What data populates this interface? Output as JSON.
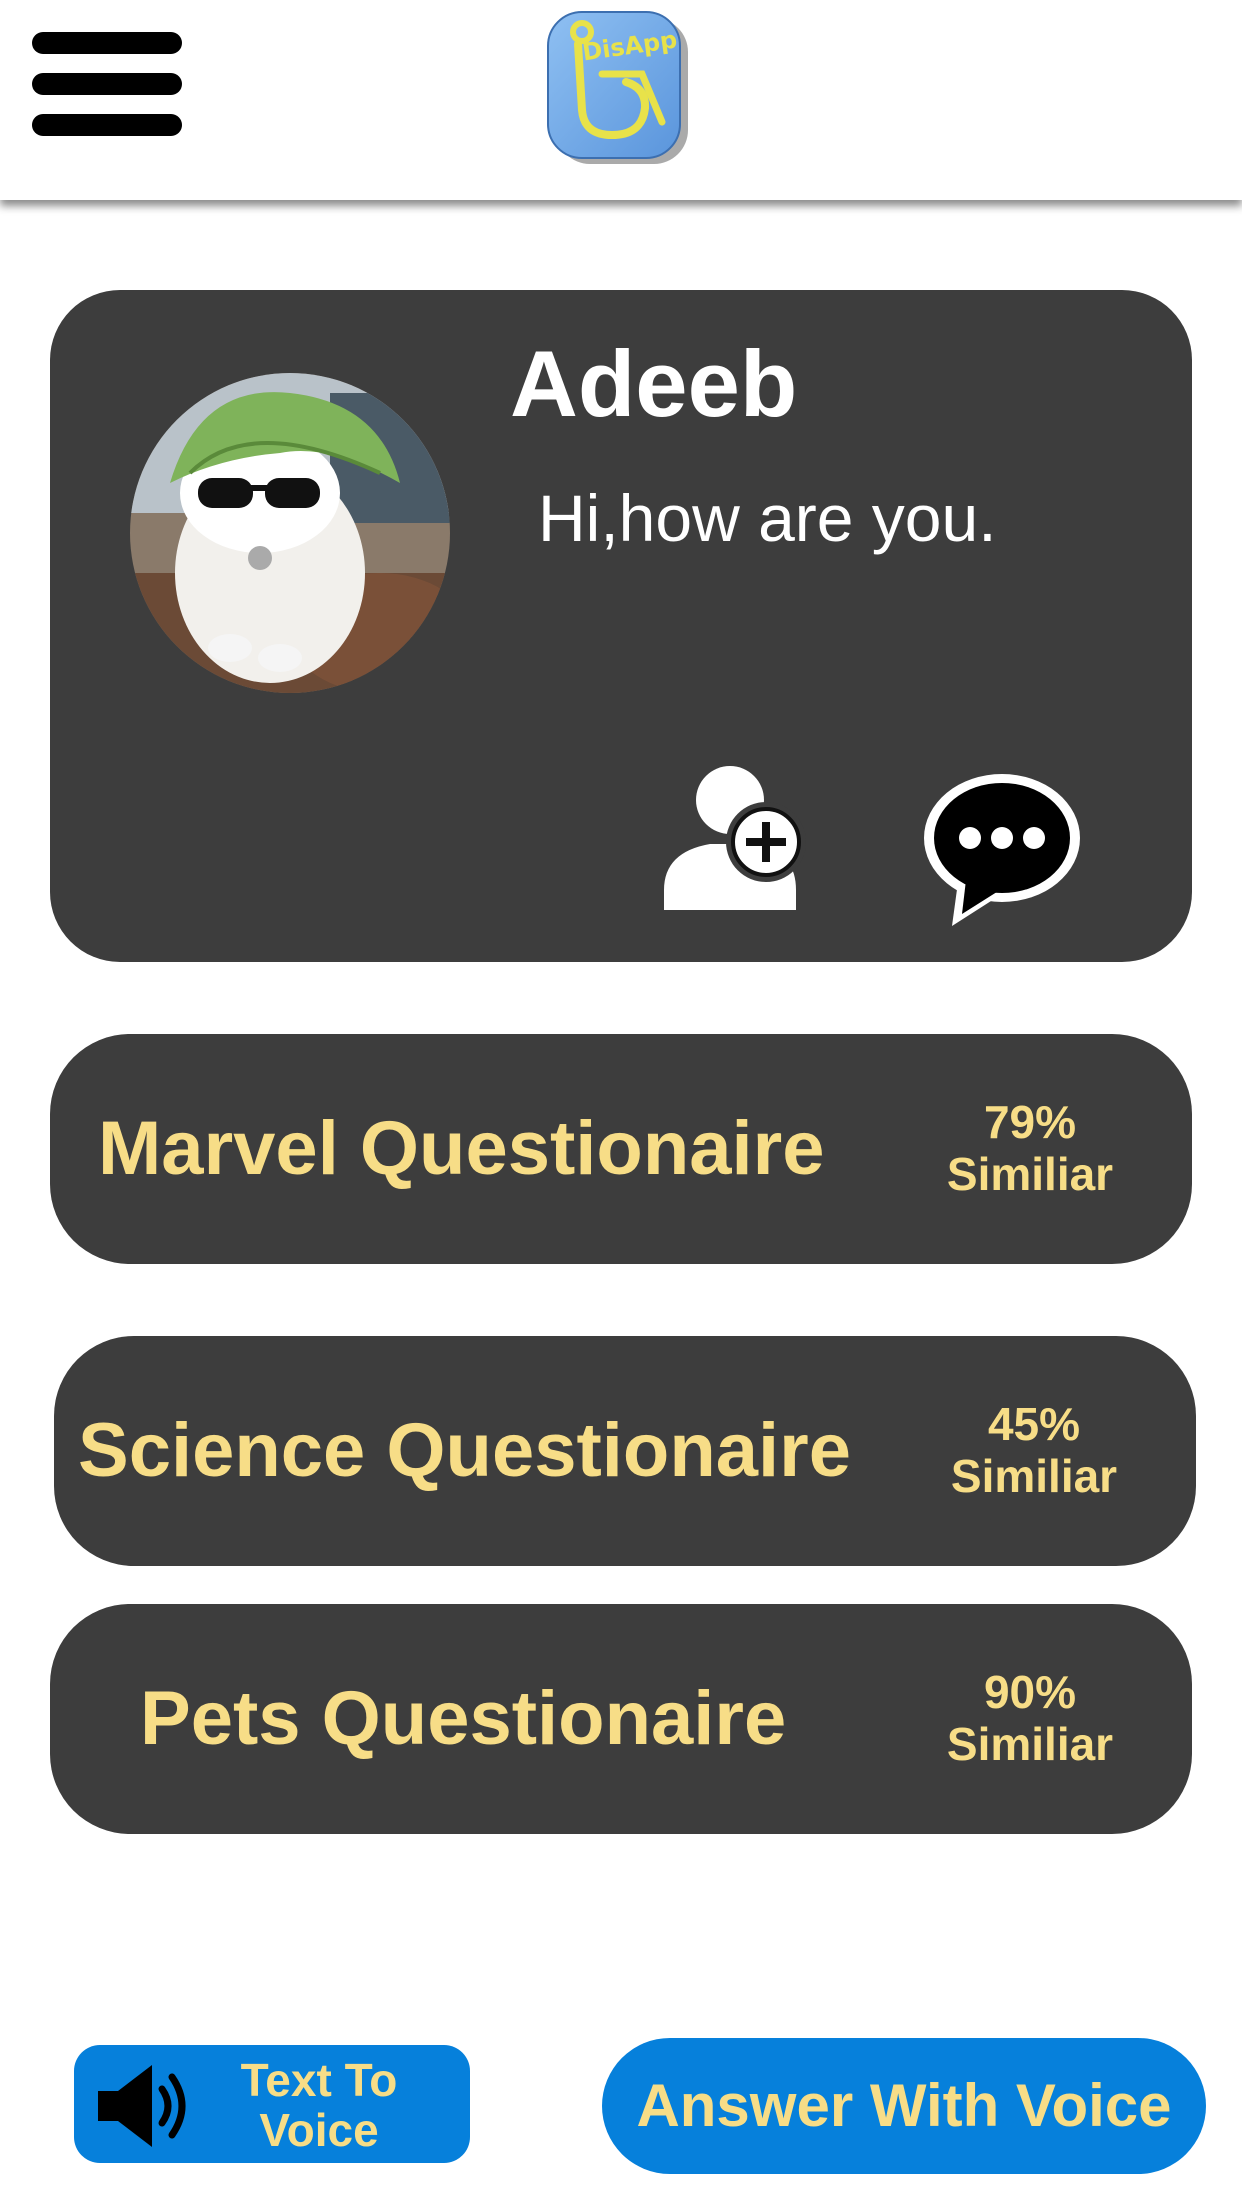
{
  "header": {
    "logo_text": "DisApp"
  },
  "profile": {
    "name": "Adeeb",
    "status": "Hi,how are you."
  },
  "questionnaires": [
    {
      "title": "Marvel Questionaire",
      "percent": "79%",
      "similar_label": "Similiar"
    },
    {
      "title": "Science Questionaire",
      "percent": "45%",
      "similar_label": "Similiar"
    },
    {
      "title": "Pets Questionaire",
      "percent": "90%",
      "similar_label": "Similiar"
    }
  ],
  "actions": {
    "text_to_voice_line1": "Text To",
    "text_to_voice_line2": "Voice",
    "answer_with_voice": "Answer With Voice"
  },
  "colors": {
    "card_bg": "#3d3d3d",
    "accent_text": "#f7dd87",
    "button_blue": "#0680db",
    "logo_blue": "#6aa7e8",
    "logo_yellow": "#e8e24a"
  },
  "icons": {
    "menu": "hamburger-menu-icon",
    "add_friend": "add-user-icon",
    "chat": "chat-bubble-icon",
    "speaker": "speaker-icon"
  }
}
